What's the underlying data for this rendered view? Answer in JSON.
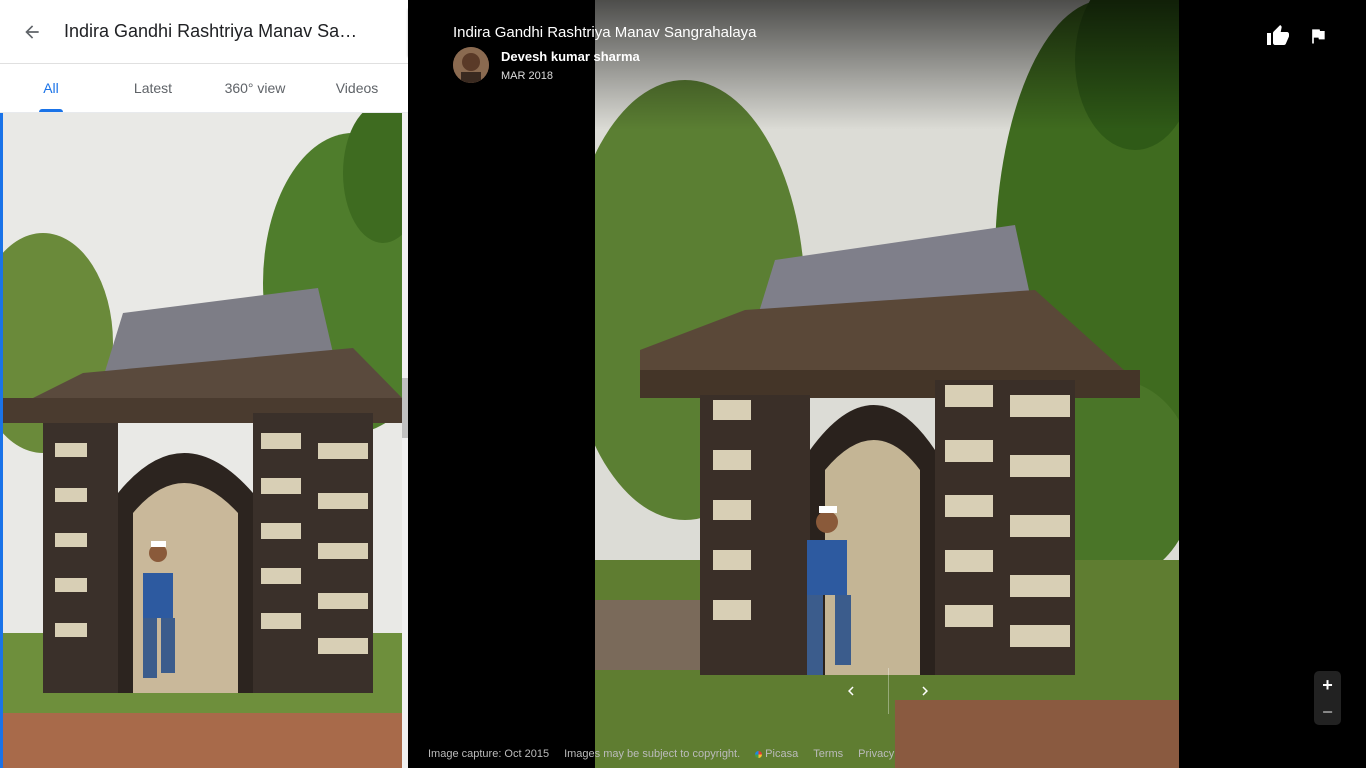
{
  "panel": {
    "title": "Indira Gandhi Rashtriya Manav Sangrahalaya",
    "tabs": [
      {
        "label": "All",
        "active": true
      },
      {
        "label": "Latest",
        "active": false
      },
      {
        "label": "360° view",
        "active": false
      },
      {
        "label": "Videos",
        "active": false
      }
    ]
  },
  "viewer": {
    "place_title": "Indira Gandhi Rashtriya Manav Sangrahalaya",
    "author": "Devesh kumar sharma",
    "date": "MAR 2018",
    "zoom_in": "+",
    "zoom_out": "−"
  },
  "footer": {
    "capture": "Image capture: Oct 2015",
    "copyright": "Images may be subject to copyright.",
    "picasa": "Picasa",
    "terms": "Terms",
    "privacy": "Privacy"
  },
  "colors": {
    "accent": "#1a73e8",
    "viewer_bg": "#000000"
  },
  "icons": [
    "back-arrow-icon",
    "chevron-left-icon",
    "thumbs-up-icon",
    "flag-icon",
    "prev-arrow-icon",
    "next-arrow-icon"
  ]
}
